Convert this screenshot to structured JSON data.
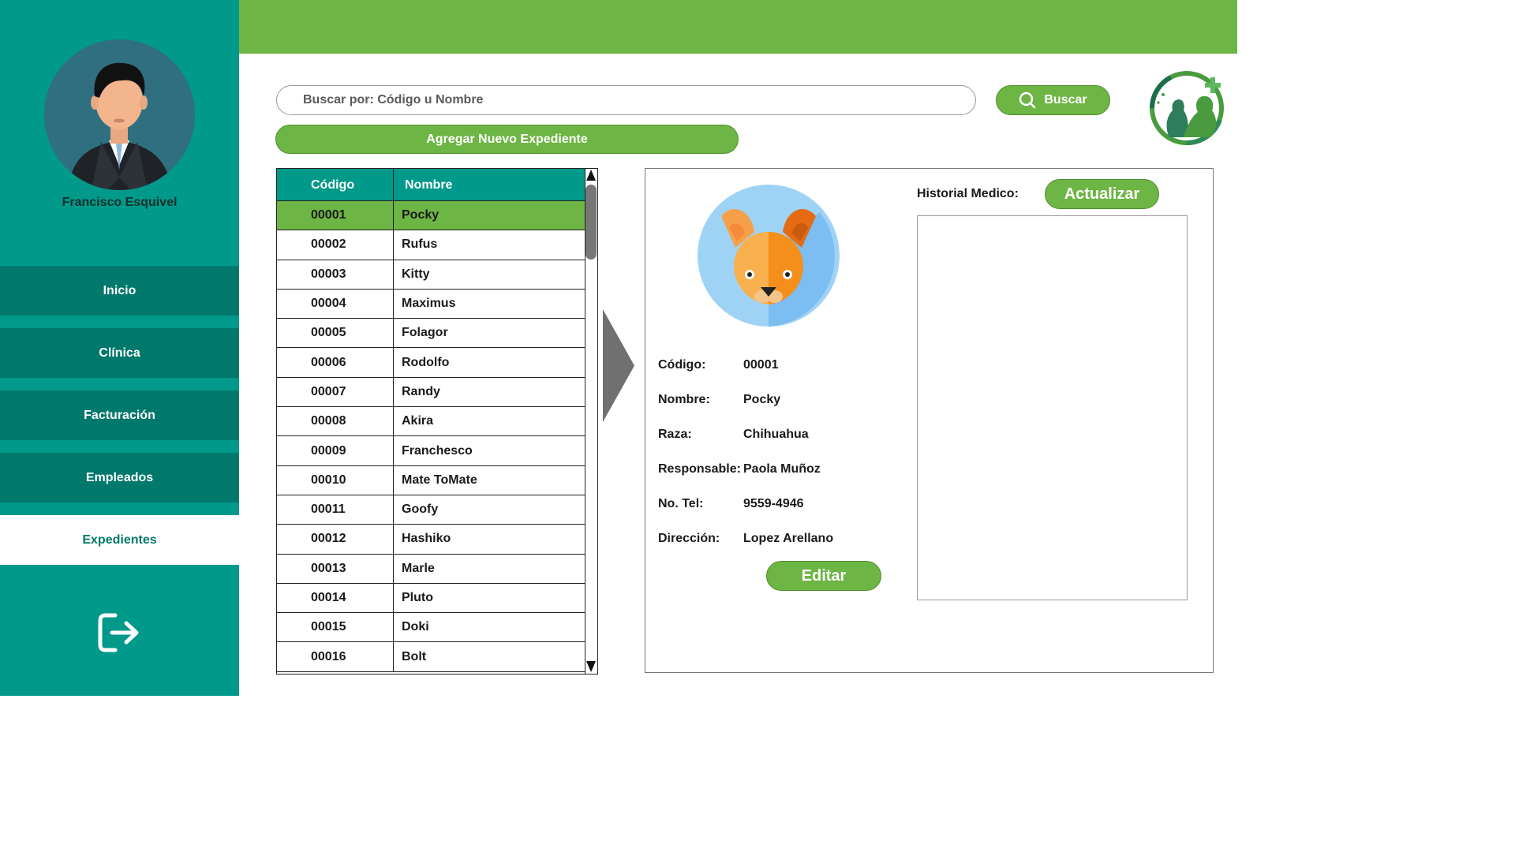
{
  "user": {
    "name": "Francisco Esquivel"
  },
  "nav": {
    "items": [
      {
        "label": "Inicio"
      },
      {
        "label": "Clínica"
      },
      {
        "label": "Facturación"
      },
      {
        "label": "Empleados"
      },
      {
        "label": "Expedientes"
      }
    ],
    "active": "Expedientes",
    "logout_icon": "logout-icon"
  },
  "search": {
    "placeholder": "Buscar por: Código u Nombre",
    "button_label": "Buscar",
    "button_icon": "search-icon"
  },
  "add_button_label": "Agregar Nuevo Expediente",
  "table": {
    "headers": {
      "code": "Código",
      "name": "Nombre"
    },
    "rows": [
      {
        "code": "00001",
        "name": "Pocky",
        "selected": true
      },
      {
        "code": "00002",
        "name": "Rufus"
      },
      {
        "code": "00003",
        "name": "Kitty"
      },
      {
        "code": "00004",
        "name": "Maximus"
      },
      {
        "code": "00005",
        "name": "Folagor"
      },
      {
        "code": "00006",
        "name": "Rodolfo"
      },
      {
        "code": "00007",
        "name": "Randy"
      },
      {
        "code": "00008",
        "name": "Akira"
      },
      {
        "code": "00009",
        "name": "Franchesco"
      },
      {
        "code": "00010",
        "name": "Mate ToMate"
      },
      {
        "code": "00011",
        "name": "Goofy"
      },
      {
        "code": "00012",
        "name": "Hashiko"
      },
      {
        "code": "00013",
        "name": "Marle"
      },
      {
        "code": "00014",
        "name": "Pluto"
      },
      {
        "code": "00015",
        "name": "Doki"
      },
      {
        "code": "00016",
        "name": "Bolt"
      }
    ]
  },
  "detail": {
    "labels": {
      "code": "Código:",
      "name": "Nombre:",
      "breed": "Raza:",
      "owner": "Responsable:",
      "phone": "No. Tel:",
      "address": "Dirección:"
    },
    "values": {
      "code": "00001",
      "name": "Pocky",
      "breed": "Chihuahua",
      "owner": "Paola Muñoz",
      "phone": "9559-4946",
      "address": "Lopez Arellano"
    },
    "edit_label": "Editar",
    "history_label": "Historial Medico:",
    "update_label": "Actualizar"
  },
  "colors": {
    "sidebar": "#00998a",
    "nav_item": "#00786b",
    "accent_green": "#6db544"
  }
}
